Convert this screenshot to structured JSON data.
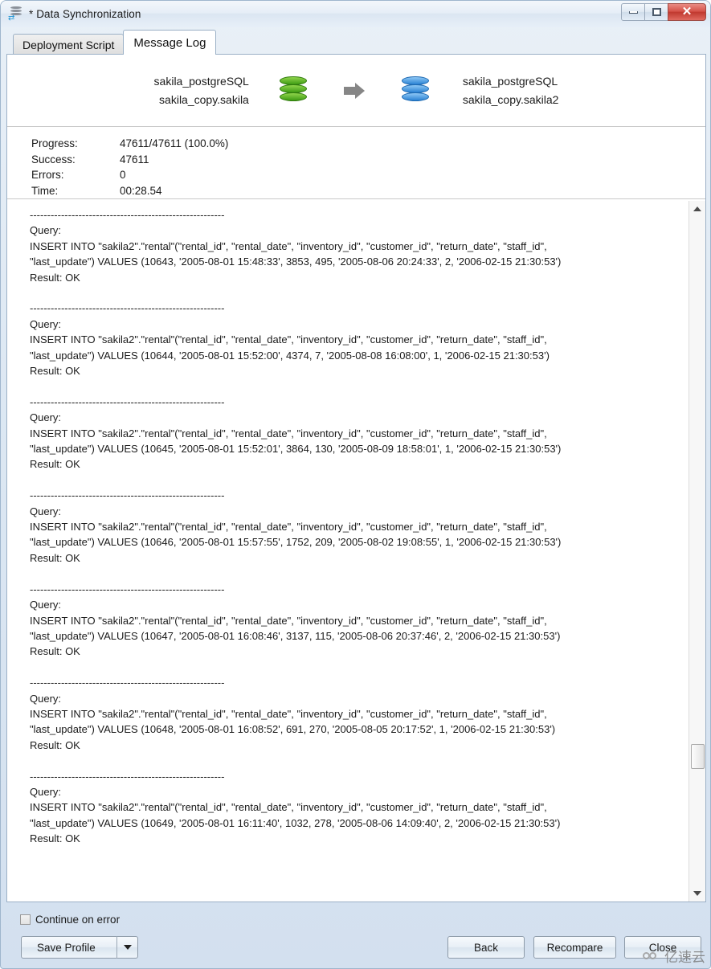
{
  "window": {
    "title": "* Data Synchronization",
    "icon": "data-sync-icon",
    "controls": {
      "minimize": "minimize",
      "maximize": "maximize",
      "close": "✕"
    }
  },
  "tabs": [
    {
      "label": "Deployment Script",
      "active": false
    },
    {
      "label": "Message Log",
      "active": true
    }
  ],
  "sync_header": {
    "source": {
      "line1": "sakila_postgreSQL",
      "line2": "sakila_copy.sakila",
      "icon": "database-icon",
      "color": "#4fae1e"
    },
    "target": {
      "line1": "sakila_postgreSQL",
      "line2": "sakila_copy.sakila2",
      "icon": "database-icon",
      "color": "#2a82d4"
    },
    "arrow": "arrow-right-icon"
  },
  "stats": [
    {
      "key": "Progress:",
      "value": "47611/47611 (100.0%)"
    },
    {
      "key": "Success:",
      "value": "47611"
    },
    {
      "key": "Errors:",
      "value": "0"
    },
    {
      "key": "Time:",
      "value": "00:28.54"
    }
  ],
  "log": {
    "separator": "--------------------------------------------------------",
    "query_label": "Query:",
    "result_label": "Result: OK",
    "entries": [
      {
        "query_line1": "INSERT INTO \"sakila2\".\"rental\"(\"rental_id\", \"rental_date\", \"inventory_id\", \"customer_id\", \"return_date\", \"staff_id\",",
        "query_line2": "\"last_update\") VALUES (10643, '2005-08-01 15:48:33', 3853, 495, '2005-08-06 20:24:33', 2, '2006-02-15 21:30:53')",
        "result": "Result: OK"
      },
      {
        "query_line1": "INSERT INTO \"sakila2\".\"rental\"(\"rental_id\", \"rental_date\", \"inventory_id\", \"customer_id\", \"return_date\", \"staff_id\",",
        "query_line2": "\"last_update\") VALUES (10644, '2005-08-01 15:52:00', 4374, 7, '2005-08-08 16:08:00', 1, '2006-02-15 21:30:53')",
        "result": "Result: OK"
      },
      {
        "query_line1": "INSERT INTO \"sakila2\".\"rental\"(\"rental_id\", \"rental_date\", \"inventory_id\", \"customer_id\", \"return_date\", \"staff_id\",",
        "query_line2": "\"last_update\") VALUES (10645, '2005-08-01 15:52:01', 3864, 130, '2005-08-09 18:58:01', 1, '2006-02-15 21:30:53')",
        "result": "Result: OK"
      },
      {
        "query_line1": "INSERT INTO \"sakila2\".\"rental\"(\"rental_id\", \"rental_date\", \"inventory_id\", \"customer_id\", \"return_date\", \"staff_id\",",
        "query_line2": "\"last_update\") VALUES (10646, '2005-08-01 15:57:55', 1752, 209, '2005-08-02 19:08:55', 1, '2006-02-15 21:30:53')",
        "result": "Result: OK"
      },
      {
        "query_line1": "INSERT INTO \"sakila2\".\"rental\"(\"rental_id\", \"rental_date\", \"inventory_id\", \"customer_id\", \"return_date\", \"staff_id\",",
        "query_line2": "\"last_update\") VALUES (10647, '2005-08-01 16:08:46', 3137, 115, '2005-08-06 20:37:46', 2, '2006-02-15 21:30:53')",
        "result": "Result: OK"
      },
      {
        "query_line1": "INSERT INTO \"sakila2\".\"rental\"(\"rental_id\", \"rental_date\", \"inventory_id\", \"customer_id\", \"return_date\", \"staff_id\",",
        "query_line2": "\"last_update\") VALUES (10648, '2005-08-01 16:08:52', 691, 270, '2005-08-05 20:17:52', 1, '2006-02-15 21:30:53')",
        "result": "Result: OK"
      },
      {
        "query_line1": "INSERT INTO \"sakila2\".\"rental\"(\"rental_id\", \"rental_date\", \"inventory_id\", \"customer_id\", \"return_date\", \"staff_id\",",
        "query_line2": "\"last_update\") VALUES (10649, '2005-08-01 16:11:40', 1032, 278, '2005-08-06 14:09:40', 2, '2006-02-15 21:30:53')",
        "result": "Result: OK"
      }
    ]
  },
  "footer": {
    "continue_on_error": {
      "label": "Continue on error",
      "checked": false
    },
    "save_profile": "Save Profile",
    "back": "Back",
    "recompare": "Recompare",
    "close": "Close"
  },
  "watermark": {
    "text": "亿速云"
  }
}
